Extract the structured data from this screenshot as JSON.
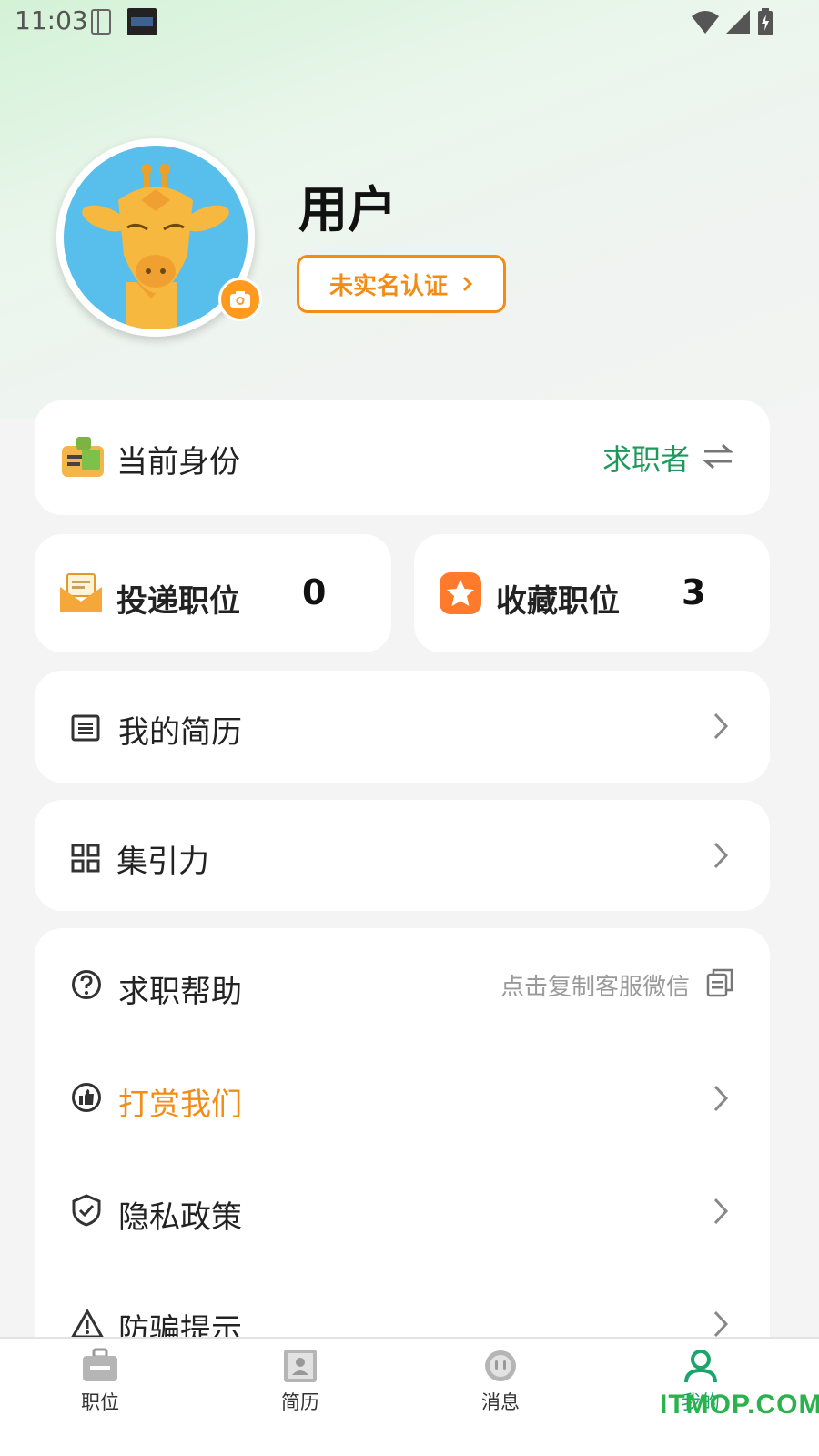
{
  "status_bar": {
    "time": "11:03"
  },
  "profile": {
    "username": "用户",
    "verify_label": "未实名认证"
  },
  "identity": {
    "label": "当前身份",
    "value": "求职者"
  },
  "stats": [
    {
      "label": "投递职位",
      "value": "0"
    },
    {
      "label": "收藏职位",
      "value": "3"
    }
  ],
  "menu": {
    "resume": "我的简历",
    "attract": "集引力",
    "help": "求职帮助",
    "help_hint": "点击复制客服微信",
    "reward": "打赏我们",
    "privacy": "隐私政策",
    "fraud": "防骗提示"
  },
  "bottom_nav": [
    {
      "label": "职位"
    },
    {
      "label": "简历"
    },
    {
      "label": "消息"
    },
    {
      "label": "我的"
    }
  ],
  "watermark": "ITMOP.COM",
  "colors": {
    "accent_green": "#1d9a5b",
    "accent_orange": "#f48c14",
    "active_tab": "#1aa56a"
  }
}
